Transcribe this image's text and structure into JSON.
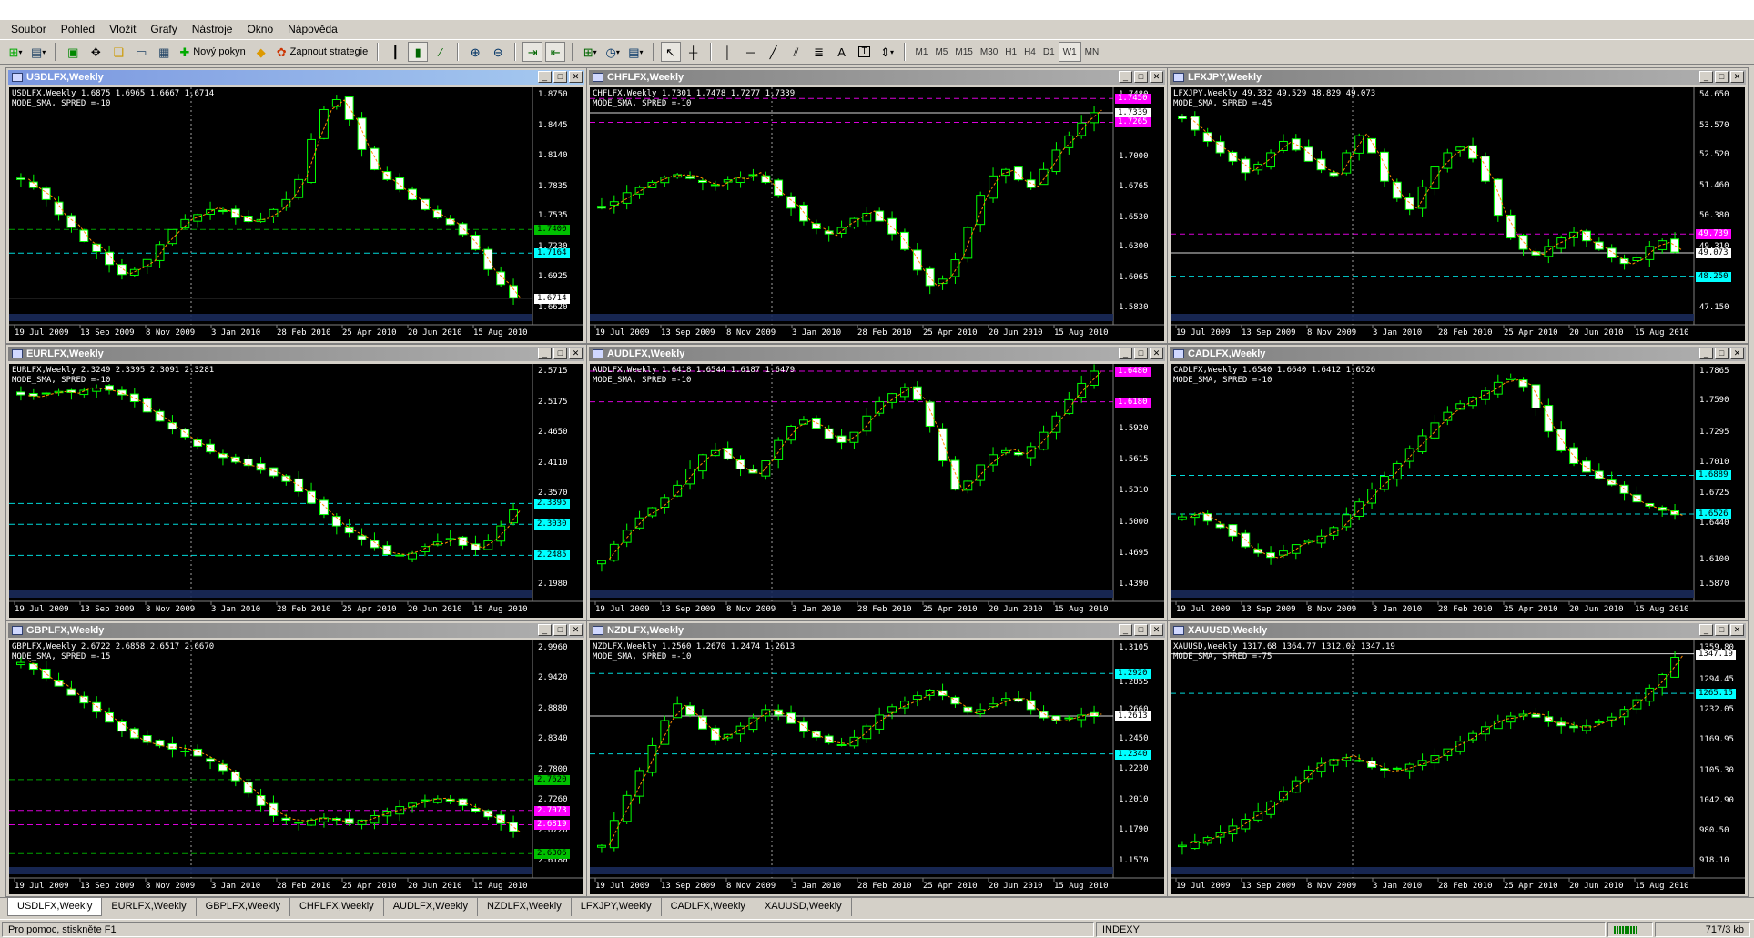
{
  "menu": [
    "Soubor",
    "Pohled",
    "Vložit",
    "Grafy",
    "Nástroje",
    "Okno",
    "Nápověda"
  ],
  "toolbar": {
    "new_order": "Nový pokyn",
    "strategies": "Zapnout strategie",
    "timeframes": [
      "M1",
      "M5",
      "M15",
      "M30",
      "H1",
      "H4",
      "D1",
      "W1",
      "MN"
    ],
    "active_tf": "W1",
    "font_tool": "A",
    "text_tool": "T"
  },
  "dates": [
    "19 Jul 2009",
    "13 Sep 2009",
    "8 Nov 2009",
    "3 Jan 2010",
    "28 Feb 2010",
    "25 Apr 2010",
    "20 Jun 2010",
    "15 Aug 2010"
  ],
  "charts": [
    {
      "id": "usdlfx",
      "title": "USDLFX,Weekly",
      "info1": "USDLFX,Weekly  1.6875 1.6965 1.6667 1.6714",
      "info2": "MODE_SMA, SPRED =-10",
      "scale": [
        "1.8750",
        "1.8445",
        "1.8140",
        "1.7835",
        "1.7535",
        "1.7230",
        "1.6925",
        "1.6620"
      ],
      "tags": [
        {
          "text": "1.7400",
          "color": "#00c000",
          "fg": "#000"
        },
        {
          "text": "1.7164",
          "color": "#00ffff",
          "fg": "#000"
        },
        {
          "text": "1.6714",
          "color": "#ffffff",
          "fg": "#000"
        }
      ],
      "series": [
        1.79,
        1.782,
        1.77,
        1.755,
        1.742,
        1.728,
        1.718,
        1.705,
        1.695,
        1.7,
        1.71,
        1.725,
        1.74,
        1.75,
        1.755,
        1.76,
        1.758,
        1.752,
        1.748,
        1.75,
        1.76,
        1.77,
        1.79,
        1.83,
        1.86,
        1.87,
        1.85,
        1.82,
        1.8,
        1.79,
        1.78,
        1.77,
        1.76,
        1.752,
        1.745,
        1.735,
        1.72,
        1.7,
        1.685,
        1.672
      ]
    },
    {
      "id": "chflfx",
      "title": "CHFLFX,Weekly",
      "info1": "CHFLFX,Weekly  1.7301 1.7478 1.7277 1.7339",
      "info2": "MODE_SMA, SPRED =-10",
      "scale": [
        "1.7480",
        "1.7323",
        "1.7265",
        "1.7000",
        "1.6765",
        "1.6530",
        "1.6300",
        "1.6065",
        "1.5830"
      ],
      "tags": [
        {
          "text": "1.7450",
          "color": "#ff00ff",
          "fg": "#fff"
        },
        {
          "text": "1.7339",
          "color": "#ffffff",
          "fg": "#000"
        },
        {
          "text": "1.7265",
          "color": "#ff00ff",
          "fg": "#fff"
        }
      ],
      "series": [
        1.66,
        1.665,
        1.672,
        1.676,
        1.68,
        1.684,
        1.686,
        1.683,
        1.68,
        1.678,
        1.682,
        1.684,
        1.686,
        1.68,
        1.67,
        1.66,
        1.65,
        1.644,
        1.64,
        1.645,
        1.652,
        1.656,
        1.65,
        1.64,
        1.628,
        1.612,
        1.6,
        1.605,
        1.62,
        1.645,
        1.67,
        1.685,
        1.69,
        1.682,
        1.676,
        1.69,
        1.705,
        1.716,
        1.726,
        1.734
      ]
    },
    {
      "id": "lfxjpy",
      "title": "LFXJPY,Weekly",
      "info1": "LFXJPY,Weekly  49.332 49.529 48.829 49.073",
      "info2": "MODE_SMA, SPRED =-45",
      "scale": [
        "54.650",
        "53.570",
        "52.520",
        "51.460",
        "50.380",
        "49.310",
        "48.250",
        "47.150"
      ],
      "tags": [
        {
          "text": "49.739",
          "color": "#ff00ff",
          "fg": "#fff"
        },
        {
          "text": "49.073",
          "color": "#ffffff",
          "fg": "#000"
        },
        {
          "text": "48.250",
          "color": "#00ffff",
          "fg": "#000"
        }
      ],
      "series": [
        53.8,
        53.4,
        53.0,
        52.6,
        52.3,
        51.9,
        52.2,
        52.6,
        53.0,
        52.7,
        52.3,
        52.0,
        51.8,
        52.6,
        53.2,
        52.6,
        51.6,
        51.0,
        50.6,
        51.4,
        52.1,
        52.6,
        52.8,
        52.4,
        51.6,
        50.4,
        49.6,
        49.2,
        49.0,
        49.3,
        49.6,
        49.8,
        49.5,
        49.2,
        48.9,
        48.7,
        48.9,
        49.3,
        49.5,
        49.1
      ]
    },
    {
      "id": "eurlfx",
      "title": "EURLFX,Weekly",
      "info1": "EURLFX,Weekly  2.3249 2.3395 2.3091 2.3281",
      "info2": "MODE_SMA, SPRED =-10",
      "scale": [
        "2.5715",
        "2.5175",
        "2.4650",
        "2.4110",
        "2.3570",
        "2.3030",
        "2.2495",
        "2.1980"
      ],
      "tags": [
        {
          "text": "2.3395",
          "color": "#00ffff",
          "fg": "#000"
        },
        {
          "text": "2.3030",
          "color": "#00ffff",
          "fg": "#000"
        },
        {
          "text": "2.2485",
          "color": "#00ffff",
          "fg": "#000"
        }
      ],
      "series": [
        2.53,
        2.528,
        2.532,
        2.536,
        2.534,
        2.538,
        2.542,
        2.538,
        2.53,
        2.518,
        2.5,
        2.484,
        2.47,
        2.456,
        2.44,
        2.43,
        2.42,
        2.412,
        2.406,
        2.398,
        2.388,
        2.378,
        2.36,
        2.34,
        2.32,
        2.3,
        2.288,
        2.276,
        2.262,
        2.25,
        2.248,
        2.252,
        2.264,
        2.272,
        2.278,
        2.266,
        2.258,
        2.274,
        2.3,
        2.328
      ]
    },
    {
      "id": "audlfx",
      "title": "AUDLFX,Weekly",
      "info1": "AUDLFX,Weekly  1.6418 1.6544 1.6187 1.6479",
      "info2": "MODE_SMA, SPRED =-10",
      "scale": [
        "1.6480",
        "1.6180",
        "1.5920",
        "1.5615",
        "1.5310",
        "1.5000",
        "1.4695",
        "1.4390"
      ],
      "tags": [
        {
          "text": "1.6480",
          "color": "#ff00ff",
          "fg": "#fff"
        },
        {
          "text": "1.6180",
          "color": "#ff00ff",
          "fg": "#fff"
        }
      ],
      "series": [
        1.462,
        1.478,
        1.492,
        1.504,
        1.514,
        1.524,
        1.536,
        1.552,
        1.566,
        1.57,
        1.562,
        1.552,
        1.548,
        1.56,
        1.58,
        1.594,
        1.6,
        1.592,
        1.582,
        1.578,
        1.588,
        1.604,
        1.618,
        1.626,
        1.632,
        1.62,
        1.594,
        1.56,
        1.532,
        1.54,
        1.556,
        1.566,
        1.57,
        1.566,
        1.574,
        1.588,
        1.604,
        1.62,
        1.636,
        1.648
      ]
    },
    {
      "id": "cadlfx",
      "title": "CADLFX,Weekly",
      "info1": "CADLFX,Weekly  1.6540 1.6640 1.6412 1.6526",
      "info2": "MODE_SMA, SPRED =-10",
      "scale": [
        "1.7865",
        "1.7590",
        "1.7295",
        "1.7010",
        "1.6725",
        "1.6440",
        "1.6100",
        "1.5870"
      ],
      "tags": [
        {
          "text": "1.6889",
          "color": "#00ffff",
          "fg": "#000"
        },
        {
          "text": "1.6526",
          "color": "#00ffff",
          "fg": "#000"
        }
      ],
      "series": [
        1.65,
        1.652,
        1.646,
        1.64,
        1.632,
        1.622,
        1.616,
        1.612,
        1.618,
        1.624,
        1.628,
        1.632,
        1.64,
        1.652,
        1.664,
        1.676,
        1.688,
        1.7,
        1.714,
        1.726,
        1.738,
        1.748,
        1.756,
        1.762,
        1.768,
        1.776,
        1.78,
        1.772,
        1.752,
        1.73,
        1.712,
        1.7,
        1.692,
        1.686,
        1.68,
        1.672,
        1.664,
        1.66,
        1.656,
        1.652
      ]
    },
    {
      "id": "gbplfx",
      "title": "GBPLFX,Weekly",
      "info1": "GBPLFX,Weekly  2.6722 2.6858 2.6517 2.6670",
      "info2": "MODE_SMA, SPRED =-15",
      "scale": [
        "2.9960",
        "2.9420",
        "2.8880",
        "2.8340",
        "2.7800",
        "2.7260",
        "2.6720",
        "2.6180"
      ],
      "tags": [
        {
          "text": "2.7620",
          "color": "#00c000",
          "fg": "#000"
        },
        {
          "text": "2.7073",
          "color": "#ff00ff",
          "fg": "#fff"
        },
        {
          "text": "2.6819",
          "color": "#ff00ff",
          "fg": "#fff"
        },
        {
          "text": "2.6306",
          "color": "#00c000",
          "fg": "#000"
        }
      ],
      "series": [
        2.97,
        2.958,
        2.942,
        2.928,
        2.912,
        2.898,
        2.882,
        2.864,
        2.848,
        2.836,
        2.828,
        2.822,
        2.816,
        2.812,
        2.804,
        2.794,
        2.778,
        2.76,
        2.738,
        2.716,
        2.698,
        2.69,
        2.686,
        2.69,
        2.694,
        2.69,
        2.684,
        2.69,
        2.698,
        2.706,
        2.714,
        2.72,
        2.726,
        2.728,
        2.724,
        2.716,
        2.706,
        2.696,
        2.684,
        2.67
      ]
    },
    {
      "id": "nzdlfx",
      "title": "NZDLFX,Weekly",
      "info1": "NZDLFX,Weekly  1.2560 1.2670 1.2474 1.2613",
      "info2": "MODE_SMA, SPRED =-10",
      "scale": [
        "1.3105",
        "1.2855",
        "1.2660",
        "1.2450",
        "1.2230",
        "1.2010",
        "1.1790",
        "1.1570"
      ],
      "tags": [
        {
          "text": "1.2920",
          "color": "#00ffff",
          "fg": "#000"
        },
        {
          "text": "1.2613",
          "color": "#ffffff",
          "fg": "#000"
        },
        {
          "text": "1.2340",
          "color": "#00ffff",
          "fg": "#000"
        }
      ],
      "series": [
        1.168,
        1.186,
        1.204,
        1.222,
        1.24,
        1.258,
        1.27,
        1.262,
        1.252,
        1.244,
        1.248,
        1.254,
        1.26,
        1.266,
        1.262,
        1.256,
        1.25,
        1.246,
        1.242,
        1.24,
        1.246,
        1.254,
        1.262,
        1.268,
        1.272,
        1.276,
        1.28,
        1.276,
        1.27,
        1.264,
        1.266,
        1.27,
        1.274,
        1.272,
        1.266,
        1.26,
        1.258,
        1.26,
        1.262,
        1.261
      ]
    },
    {
      "id": "xauusd",
      "title": "XAUUSD,Weekly",
      "info1": "XAUUSD,Weekly  1317.68 1364.77 1312.02 1347.19",
      "info2": "MODE_SMA, SPRED =-75",
      "scale": [
        "1359.80",
        "1294.45",
        "1232.05",
        "1169.95",
        "1105.30",
        "1042.90",
        "980.50",
        "918.10"
      ],
      "tags": [
        {
          "text": "1347.19",
          "color": "#ffffff",
          "fg": "#000"
        },
        {
          "text": "1265.15",
          "color": "#00ffff",
          "fg": "#000"
        }
      ],
      "series": [
        950,
        958,
        966,
        976,
        990,
        1004,
        1020,
        1040,
        1062,
        1084,
        1106,
        1120,
        1128,
        1132,
        1124,
        1112,
        1106,
        1110,
        1118,
        1126,
        1136,
        1150,
        1166,
        1182,
        1196,
        1208,
        1218,
        1222,
        1216,
        1206,
        1198,
        1194,
        1198,
        1206,
        1216,
        1232,
        1252,
        1276,
        1304,
        1340
      ]
    }
  ],
  "tabs": [
    "USDLFX,Weekly",
    "EURLFX,Weekly",
    "GBPLFX,Weekly",
    "CHFLFX,Weekly",
    "AUDLFX,Weekly",
    "NZDLFX,Weekly",
    "LFXJPY,Weekly",
    "CADLFX,Weekly",
    "XAUUSD,Weekly"
  ],
  "active_tab": "USDLFX,Weekly",
  "status": {
    "help": "Pro pomoc, stiskněte F1",
    "profile": "INDEXY",
    "traffic": "717/3 kb"
  },
  "colors": {
    "bull": "#00ff00",
    "bear": "#ffffff",
    "sma": "#ff8c00",
    "grid": "#808080",
    "title_active": "#7a96df"
  }
}
